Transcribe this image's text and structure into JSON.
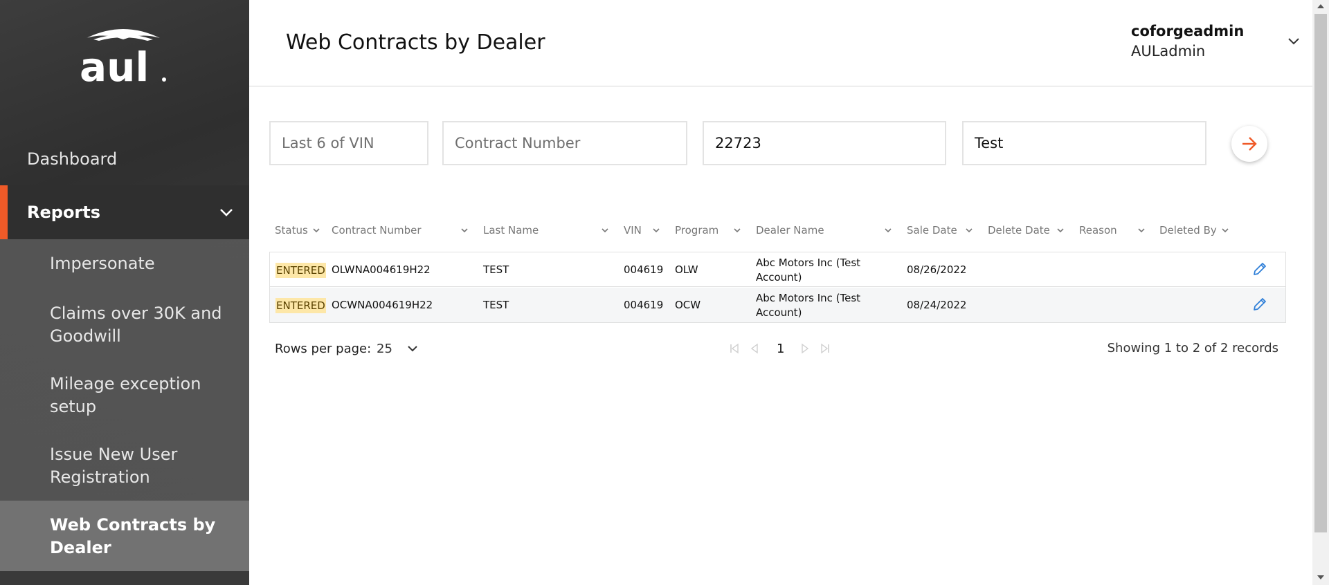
{
  "sidebar": {
    "brand": "aul",
    "items": [
      {
        "label": "Dashboard"
      },
      {
        "label": "Reports"
      }
    ],
    "submenu": [
      {
        "label": "Impersonate"
      },
      {
        "label": "Claims over 30K and Goodwill"
      },
      {
        "label": "Mileage exception setup"
      },
      {
        "label": "Issue New User Registration"
      },
      {
        "label": "Web Contracts by Dealer",
        "active": true
      }
    ]
  },
  "header": {
    "title": "Web Contracts by Dealer",
    "user_name": "coforgeadmin",
    "user_role": "AULadmin"
  },
  "filters": {
    "vin_placeholder": "Last 6 of VIN",
    "contract_placeholder": "Contract Number",
    "dealer_value": "22723",
    "name_value": "Test"
  },
  "table": {
    "columns": [
      "Status",
      "Contract Number",
      "Last Name",
      "VIN",
      "Program",
      "Dealer Name",
      "Sale Date",
      "Delete Date",
      "Reason",
      "Deleted By"
    ],
    "rows": [
      {
        "status": "ENTERED",
        "contract": "OLWNA004619H22",
        "last_name": "TEST",
        "vin": "004619",
        "program": "OLW",
        "dealer": "Abc Motors Inc (Test Account)",
        "sale_date": "08/26/2022",
        "delete_date": "",
        "reason": "",
        "deleted_by": ""
      },
      {
        "status": "ENTERED",
        "contract": "OCWNA004619H22",
        "last_name": "TEST",
        "vin": "004619",
        "program": "OCW",
        "dealer": "Abc Motors Inc (Test Account)",
        "sale_date": "08/24/2022",
        "delete_date": "",
        "reason": "",
        "deleted_by": ""
      }
    ]
  },
  "pagination": {
    "rows_per_page_label": "Rows per page:",
    "rows_per_page": "25",
    "current_page": "1",
    "summary": "Showing 1 to 2 of 2 records"
  },
  "colors": {
    "accent": "#ef5a28",
    "badge": "#fde7a8",
    "edit_icon": "#2f7fd8"
  }
}
